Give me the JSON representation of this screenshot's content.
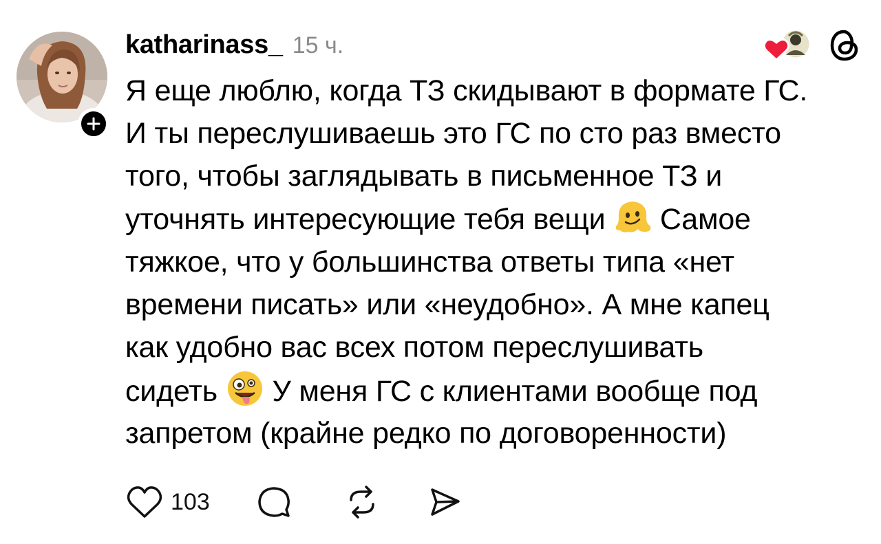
{
  "post": {
    "username": "katharinass_",
    "time": "15 ч.",
    "text_line1": "Я еще люблю, когда ТЗ скидывают в формате ГС.",
    "text_line2": "И ты переслушиваешь это ГС по сто раз вместо",
    "text_line3": "того, чтобы заглядывать в письменное ТЗ и",
    "text_line4_a": "уточнять интересующие тебя вещи ",
    "text_line4_b": " Самое",
    "text_line5": "тяжкое, что у большинства ответы типа «нет",
    "text_line6": "времени писать» или «неудобно». А мне капец",
    "text_line7": "как удобно вас всех потом переслушивать",
    "text_line8_a": "сидеть ",
    "text_line8_b": " У меня ГС с клиентами вообще под",
    "text_line9": "запретом (крайне редко по договоренности)",
    "emojis": [
      "melting-face",
      "zany-face"
    ]
  },
  "actions": {
    "like_count": "103",
    "icons": [
      "heart-icon",
      "comment-icon",
      "repost-icon",
      "share-icon"
    ]
  },
  "icons": {
    "top_right": [
      "liked-by-avatar",
      "threads-logo-icon"
    ]
  },
  "colors": {
    "text": "#000000",
    "muted": "#8a8a8a",
    "heart": "#ee1d3c",
    "emoji_yellow": "#f7c63a"
  }
}
